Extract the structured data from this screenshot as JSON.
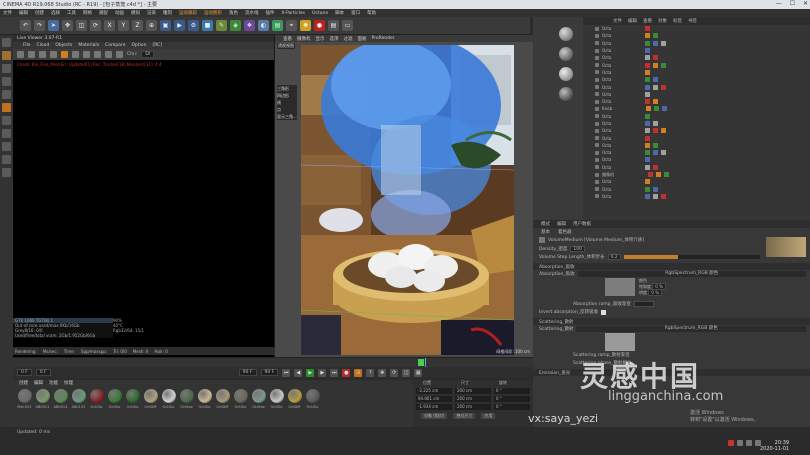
{
  "titlebar": {
    "title": "CINEMA 4D R19.068 Studio (RC - R19) - [包子蒸笼.c4d *] - 主要",
    "controls": [
      "—",
      "☐",
      "✕"
    ]
  },
  "menubar": {
    "items": [
      "文件",
      "编辑",
      "创建",
      "选择",
      "工具",
      "网格",
      "捕捉",
      "动画",
      "模拟",
      "渲染",
      "雕刻",
      "运动跟踪",
      "运动图形",
      "角色",
      "流水线",
      "插件",
      "X-Particles",
      "Octane",
      "脚本",
      "窗口",
      "帮助"
    ],
    "highlight": [
      "运动跟踪",
      "运动图形"
    ]
  },
  "liveviewer": {
    "title": "Live Viewer 3.07-R1",
    "menu": [
      "File",
      "Cloud",
      "Objects",
      "Materials",
      "Compare",
      "Option",
      "[RC]"
    ],
    "channel_label": "Chn:",
    "channel_value": "Dl",
    "status_line": "Check: Bin_Fine_Miss(Err: Updated[1] Rec: Tracker[18] Miss(err)[11]: 4.4",
    "stats": [
      "GTX 1060 TGT(8) 1",
      "Out-of-core used/max:0Kb/16Gb",
      "Grey8/16: 0/0",
      "Used/free/total vram: 2Gb/1.952Gb/6Gb"
    ],
    "stats_right": [
      "90%",
      "40°C",
      "Rgb32/64: 15/1"
    ],
    "bottom": [
      "Rendering:",
      "Ms/sec:",
      "Time:",
      "Spp/maxspp:",
      "Tri: 0/0",
      "Mesh: 0",
      "Hair: 0"
    ]
  },
  "viewport": {
    "menu": [
      "查看",
      "摄像机",
      "显示",
      "选项",
      "过滤",
      "面板",
      "ProRender"
    ],
    "label": "透视视图",
    "side_lines": [
      "三角形",
      "四边形",
      "线",
      "点",
      "显示三角..."
    ],
    "scale": "网格间距: 100 cm"
  },
  "timeline": {
    "frame_start": "0 F",
    "frame_current": "0 F",
    "frame_end": "90 F",
    "frame_max": "90 F"
  },
  "materials": {
    "menu": [
      "创建",
      "编辑",
      "功能",
      "纹理"
    ],
    "items": [
      {
        "name": "Mat.001",
        "color": "#6a6a6a"
      },
      {
        "name": "AB0011",
        "color": "#7a9a6a"
      },
      {
        "name": "AB0014",
        "color": "#5a8a5a"
      },
      {
        "name": "AB0115",
        "color": "#6a9a7a"
      },
      {
        "name": "OctSlic",
        "color": "#8a2020"
      },
      {
        "name": "OctGlo",
        "color": "#3a7a3a"
      },
      {
        "name": "OctGlo",
        "color": "#2a6a2a"
      },
      {
        "name": "OctDiff",
        "color": "#b0a080"
      },
      {
        "name": "OctGlo",
        "color": "#d0d0d0"
      },
      {
        "name": "OctSpe",
        "color": "#4a6a4a"
      },
      {
        "name": "OctGlo",
        "color": "#c8b890"
      },
      {
        "name": "OctDiff",
        "color": "#a89878"
      },
      {
        "name": "OctGlo",
        "color": "#6a6a5a"
      },
      {
        "name": "OctSpe",
        "color": "#7a9a8a"
      },
      {
        "name": "OctGlo",
        "color": "#c8c8c0"
      },
      {
        "name": "OctDiff",
        "color": "#b89a40"
      },
      {
        "name": "OctGlo",
        "color": "#5a5a5a"
      }
    ]
  },
  "coords": {
    "headers": [
      "位置",
      "尺寸",
      "旋转"
    ],
    "rows": [
      {
        "p": "-2.225 cm",
        "s": "200 cm",
        "r": "0 °"
      },
      {
        "p": "94.661 cm",
        "s": "200 cm",
        "r": "0 °"
      },
      {
        "p": "-1.934 cm",
        "s": "200 cm",
        "r": "0 °"
      }
    ],
    "mode": "对象 (相对)",
    "size_mode": "绝对尺寸",
    "apply": "应用"
  },
  "statusbar": {
    "text": "Updated: 0 ms"
  },
  "objects": {
    "tabs": [
      "文件",
      "编辑",
      "查看",
      "对象",
      "标签",
      "书签"
    ],
    "rows": [
      "Octa",
      "Octa",
      "Octa",
      "Octa",
      "Octa",
      "Octa",
      "Octa",
      "Octa",
      "Octa",
      "Octa",
      "Octa",
      "Knob",
      "Octa",
      "Octa",
      "Octa",
      "Octa",
      "Octa",
      "Octa",
      "Octa",
      "Octa",
      "摄像机",
      "Octa",
      "Octa",
      "Octa"
    ]
  },
  "attributes": {
    "tabs": [
      "模式",
      "编辑",
      "用户数据"
    ],
    "sub": [
      "基本",
      "着色器"
    ],
    "title": "VolumeMedium [Volume Medium_体积介质]",
    "density_label": "Density_密度",
    "density_value": "100",
    "step_label": "Volume Step Length_体积步长",
    "step_value": "0.2",
    "absorption_section": "Absorption_吸收",
    "absorption_label": "Absorption_吸收",
    "absorption_value": "RgbSpectrum_RGB 颜色",
    "mix_labels": [
      "颜色",
      "饱和度",
      "明度"
    ],
    "mix_values": [
      "0 %",
      "0 %",
      ""
    ],
    "ramp_label": "Absorption ramp_吸收渐变",
    "invert_label": "Invert absorption_反转吸收",
    "scattering_section": "Scattering_散射",
    "scattering_label": "Scattering_散射",
    "scattering_value": "RgbSpectrum_RGB 颜色",
    "scattering_ramp": "Scattering ramp_散射渐变",
    "scattering_phase": "Scattering phase_散射相位",
    "emission_section": "Emission_发光"
  },
  "overlay": {
    "watermark_cn": "灵感中国",
    "watermark_url": "lingganchina.com",
    "wechat": "vx:saya_yezi",
    "activate": [
      "激活 Windows",
      "转到\"设置\"以激活 Windows。"
    ],
    "time": "20:39",
    "date": "2020-11-01"
  },
  "colors": {
    "accent": "#e8a030",
    "green": "#4cd04c",
    "cyan": "#40c0c0",
    "error": "#c03030"
  }
}
